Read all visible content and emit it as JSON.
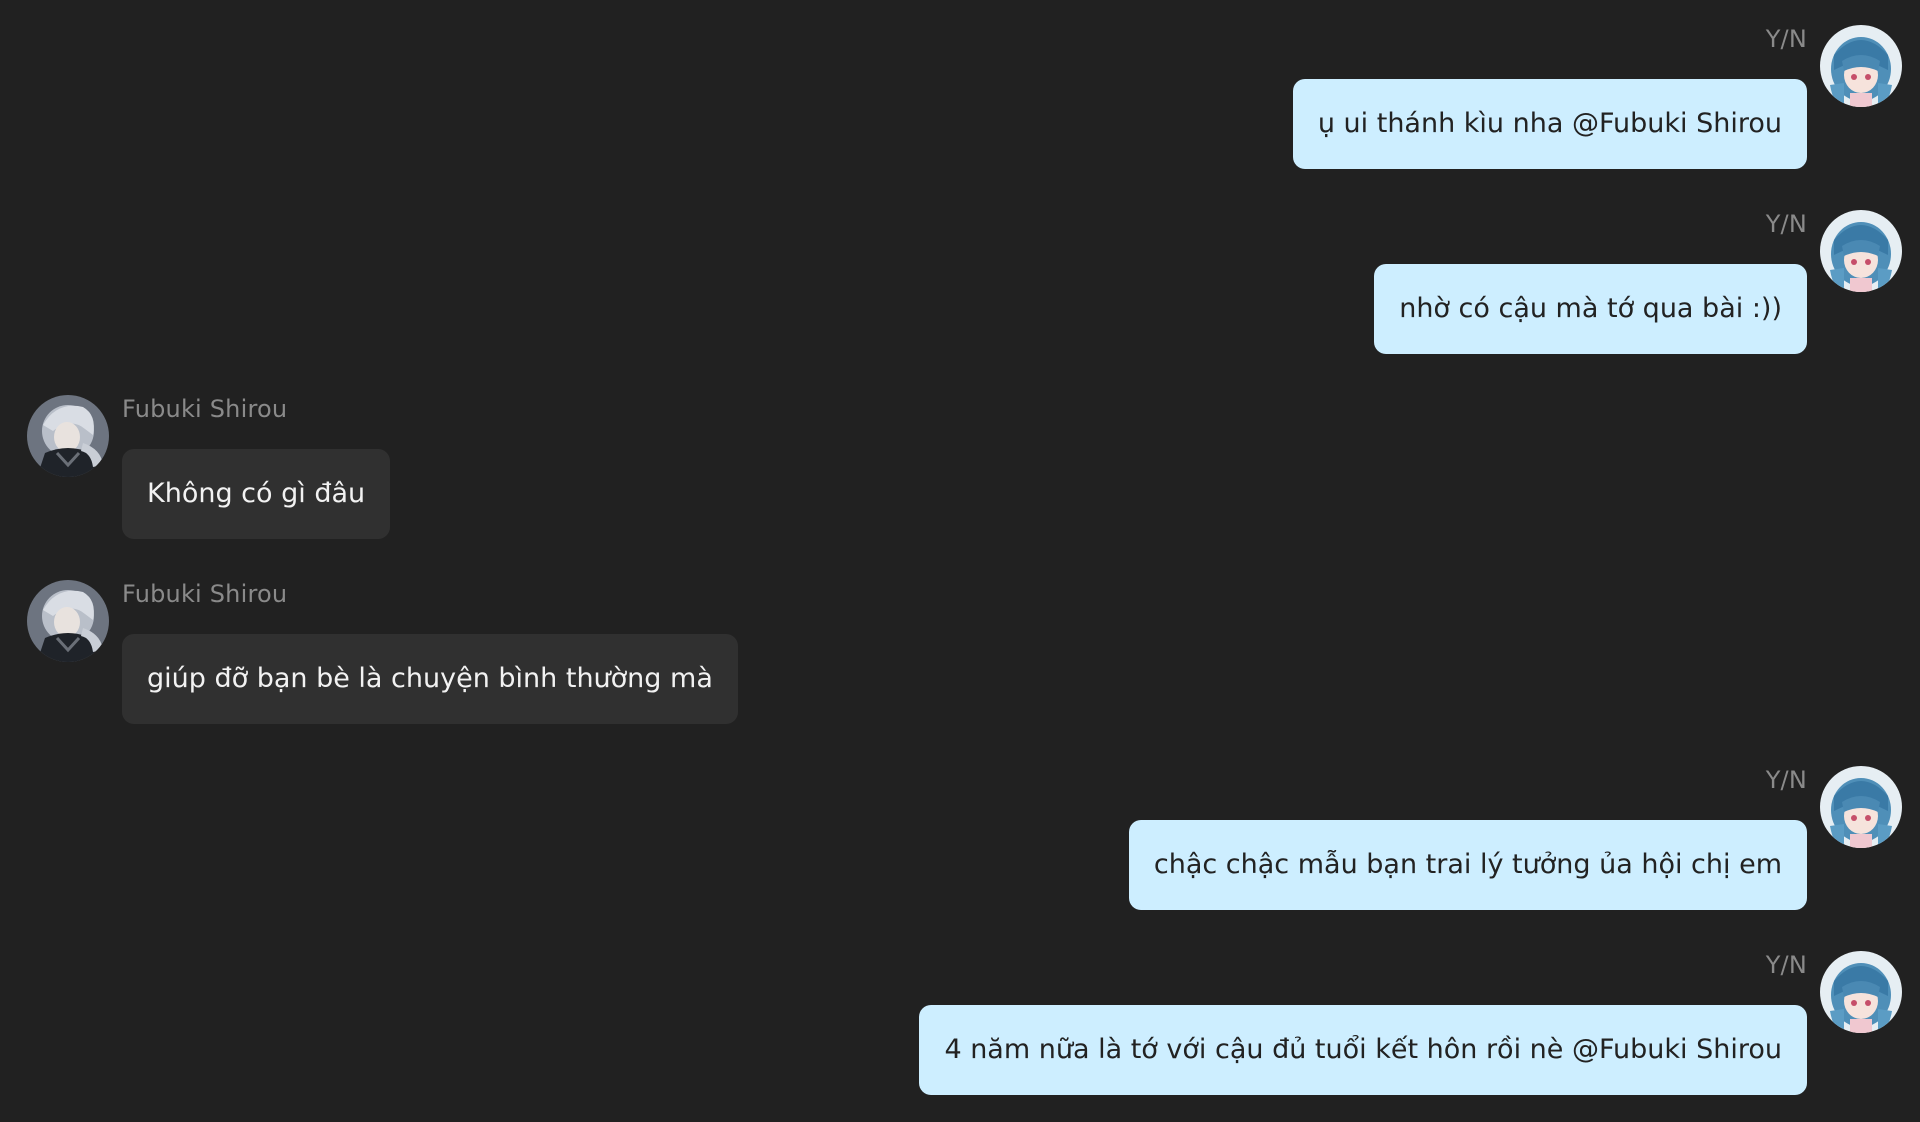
{
  "colors": {
    "background": "#212121",
    "outgoing_bubble": "#cdeeff",
    "incoming_bubble": "#303030",
    "sender_name": "#8a8a8a"
  },
  "messages": [
    {
      "sender": "Y/N",
      "text": "ụ ui thánh kìu nha @Fubuki Shirou",
      "side": "right",
      "avatar": "yn-avatar"
    },
    {
      "sender": "Y/N",
      "text": "nhờ có cậu mà tớ qua bài :))",
      "side": "right",
      "avatar": "yn-avatar"
    },
    {
      "sender": "Fubuki Shirou",
      "text": "Không có gì đâu",
      "side": "left",
      "avatar": "fubuki-avatar"
    },
    {
      "sender": "Fubuki Shirou",
      "text": "giúp đỡ bạn bè là chuyện bình thường mà",
      "side": "left",
      "avatar": "fubuki-avatar"
    },
    {
      "sender": "Y/N",
      "text": "chậc chậc mẫu bạn trai lý tưởng ủa hội chị em",
      "side": "right",
      "avatar": "yn-avatar"
    },
    {
      "sender": "Y/N",
      "text": "4 năm nữa là tớ với cậu đủ tuổi kết hôn rồi nè @Fubuki Shirou",
      "side": "right",
      "avatar": "yn-avatar"
    }
  ]
}
